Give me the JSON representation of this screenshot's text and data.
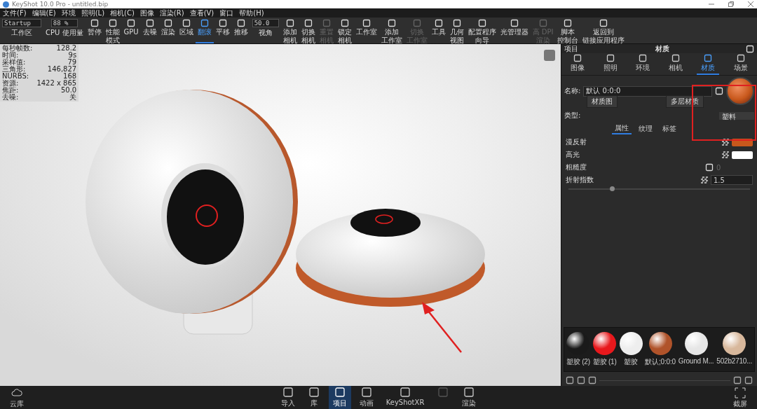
{
  "window": {
    "title": "KeyShot 10.0 Pro  - untitled.bip"
  },
  "menu": [
    "文件(F)",
    "编辑(E)",
    "环境",
    "照明(L)",
    "相机(C)",
    "图像",
    "渲染(R)",
    "查看(V)",
    "窗口",
    "帮助(H)"
  ],
  "toolbar": [
    {
      "kind": "field",
      "value": "Startup",
      "label": "工作区"
    },
    {
      "kind": "field",
      "value": "88 %",
      "label": "CPU 使用量"
    },
    {
      "kind": "button",
      "label": "暂停",
      "disabled": false,
      "selected": false
    },
    {
      "kind": "button",
      "lines": [
        "性能",
        "模式"
      ],
      "disabled": false,
      "selected": false
    },
    {
      "kind": "button",
      "label": "GPU",
      "disabled": false,
      "selected": false
    },
    {
      "kind": "button",
      "label": "去噪",
      "disabled": false,
      "selected": false
    },
    {
      "kind": "button",
      "label": "渲染",
      "disabled": false,
      "selected": false
    },
    {
      "kind": "button",
      "label": "区域",
      "disabled": false,
      "selected": false
    },
    {
      "kind": "button",
      "label": "翻滚",
      "disabled": false,
      "selected": true
    },
    {
      "kind": "button",
      "label": "平移",
      "disabled": false,
      "selected": false
    },
    {
      "kind": "button",
      "label": "推移",
      "disabled": false,
      "selected": false
    },
    {
      "kind": "field",
      "value": "50.0",
      "label": "视角"
    },
    {
      "kind": "button",
      "lines": [
        "添加",
        "相机"
      ],
      "disabled": false,
      "selected": false
    },
    {
      "kind": "button",
      "lines": [
        "切换",
        "相机"
      ],
      "disabled": false,
      "selected": false
    },
    {
      "kind": "button",
      "lines": [
        "重置",
        "相机"
      ],
      "disabled": true,
      "selected": false
    },
    {
      "kind": "button",
      "lines": [
        "锁定",
        "相机"
      ],
      "disabled": false,
      "selected": false
    },
    {
      "kind": "button",
      "label": "工作室",
      "disabled": false,
      "selected": false
    },
    {
      "kind": "button",
      "lines": [
        "添加",
        "工作室"
      ],
      "disabled": false,
      "selected": false
    },
    {
      "kind": "button",
      "lines": [
        "切换",
        "工作室"
      ],
      "disabled": true,
      "selected": false
    },
    {
      "kind": "button",
      "label": "工具",
      "disabled": false,
      "selected": false
    },
    {
      "kind": "button",
      "lines": [
        "几何",
        "视图"
      ],
      "disabled": false,
      "selected": false
    },
    {
      "kind": "button",
      "lines": [
        "配置程序",
        "向导"
      ],
      "disabled": false,
      "selected": false
    },
    {
      "kind": "button",
      "label": "光管理器",
      "disabled": false,
      "selected": false
    },
    {
      "kind": "button",
      "lines": [
        "高 DPI",
        "渲染"
      ],
      "disabled": true,
      "selected": false
    },
    {
      "kind": "button",
      "lines": [
        "脚本",
        "控制台"
      ],
      "disabled": false,
      "selected": false
    },
    {
      "kind": "button",
      "lines": [
        "返回到",
        "链接应用程序"
      ],
      "disabled": false,
      "selected": false
    }
  ],
  "stats": [
    {
      "label": "每秒帧数:",
      "value": "128.2"
    },
    {
      "label": "时间:",
      "value": "9s"
    },
    {
      "label": "采样值:",
      "value": "79"
    },
    {
      "label": "三角形:",
      "value": "146,827"
    },
    {
      "label": "NURBS:",
      "value": "168"
    },
    {
      "label": "资源:",
      "value": "1422 x 865"
    },
    {
      "label": "焦距:",
      "value": "50.0"
    },
    {
      "label": "去噪:",
      "value": "关"
    }
  ],
  "panel": {
    "left_title": "项目",
    "title": "材质",
    "tabs": [
      {
        "label": "图像",
        "selected": false
      },
      {
        "label": "照明",
        "selected": false
      },
      {
        "label": "环境",
        "selected": false
      },
      {
        "label": "相机",
        "selected": false
      },
      {
        "label": "材质",
        "selected": true
      },
      {
        "label": "场景",
        "selected": false
      }
    ],
    "name_label": "名称:",
    "name_value": "默认 0:0:0",
    "buttons": [
      "材质图",
      "多层材质"
    ],
    "type_label": "类型:",
    "type_value": "塑料",
    "subtabs": [
      {
        "label": "属性",
        "selected": true
      },
      {
        "label": "纹理",
        "selected": false
      },
      {
        "label": "标签",
        "selected": false
      }
    ],
    "properties": [
      {
        "kind": "color",
        "label": "漫反射",
        "color": "#c8581c"
      },
      {
        "kind": "color",
        "label": "高光",
        "color": "#ffffff"
      },
      {
        "kind": "dim",
        "label": "粗糙度",
        "value": "0"
      },
      {
        "kind": "number",
        "label": "折射指数",
        "value": "1.5",
        "level": 0.24
      }
    ],
    "library": [
      {
        "name": "塑胶 (2)",
        "color": "#1a1a1a"
      },
      {
        "name": "塑胶 (1)",
        "color": "#e8181c"
      },
      {
        "name": "塑胶",
        "color": "#eeeeee"
      },
      {
        "name": "默认;0:0:0",
        "color": "#b0532a"
      },
      {
        "name": "Ground M...",
        "color": "#e6e6e6"
      },
      {
        "name": "502b2710...",
        "color": "#d8b89c"
      }
    ]
  },
  "bottom_left": "云库",
  "bottom": [
    {
      "label": "导入",
      "selected": false,
      "disabled": false
    },
    {
      "label": "库",
      "selected": false,
      "disabled": false
    },
    {
      "label": "项目",
      "selected": true,
      "disabled": false
    },
    {
      "label": "动画",
      "selected": false,
      "disabled": false
    },
    {
      "label": "KeyShotXR",
      "selected": false,
      "disabled": false
    },
    {
      "selected": false,
      "disabled": true
    },
    {
      "label": "渲染",
      "selected": false,
      "disabled": false
    }
  ],
  "bottom_right": "截屏"
}
